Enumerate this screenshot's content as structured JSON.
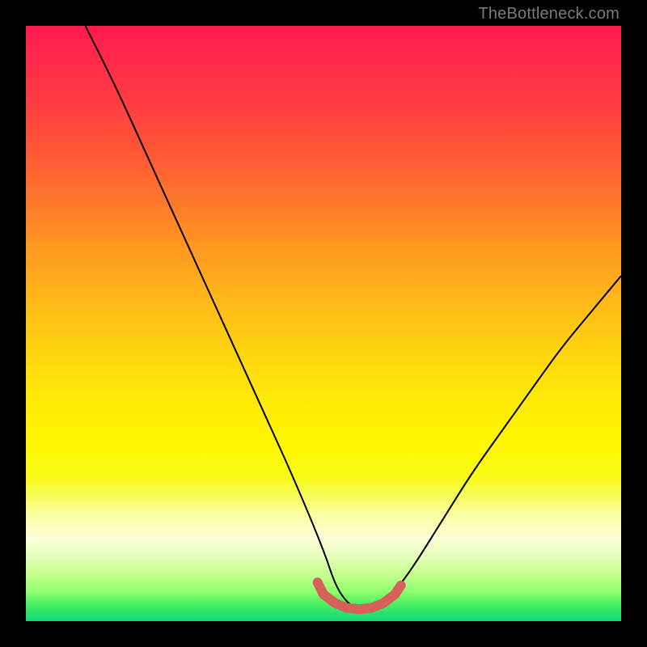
{
  "watermark": "TheBottleneck.com",
  "chart_data": {
    "type": "line",
    "title": "",
    "xlabel": "",
    "ylabel": "",
    "xlim": [
      0,
      100
    ],
    "ylim": [
      0,
      100
    ],
    "grid": false,
    "legend": false,
    "series": [
      {
        "name": "black-curve",
        "x": [
          10,
          15,
          20,
          25,
          30,
          35,
          40,
          45,
          50,
          52,
          54,
          56,
          58,
          60,
          62,
          65,
          70,
          75,
          80,
          85,
          90,
          95,
          100
        ],
        "y": [
          100,
          90,
          79,
          68,
          57,
          46,
          35,
          24,
          12,
          6,
          3,
          2,
          2,
          3,
          5,
          9,
          17,
          25,
          32,
          39,
          46,
          52,
          58
        ]
      },
      {
        "name": "red-highlight",
        "x": [
          49,
          50,
          52,
          54,
          56,
          58,
          60,
          62,
          63
        ],
        "y": [
          6.5,
          4.5,
          3,
          2.2,
          2,
          2.2,
          3,
          4.5,
          6
        ]
      }
    ],
    "gradient": {
      "direction": "vertical",
      "stops": [
        {
          "pos": 0,
          "color": "#ff1a4d"
        },
        {
          "pos": 50,
          "color": "#ffd000"
        },
        {
          "pos": 85,
          "color": "#fcffd8"
        },
        {
          "pos": 100,
          "color": "#10d878"
        }
      ]
    }
  }
}
